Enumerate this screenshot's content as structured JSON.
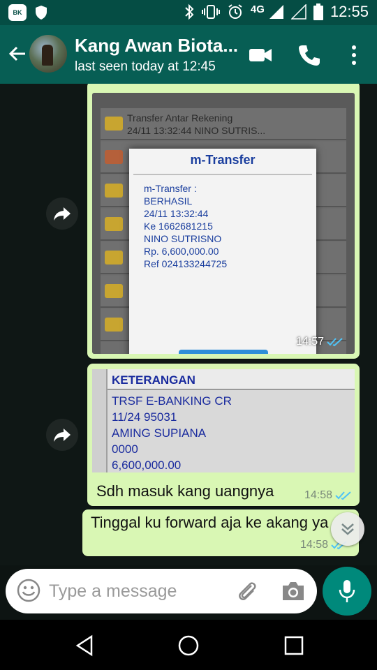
{
  "status_bar": {
    "network": "4G",
    "time": "12:55",
    "app_badge": "BK"
  },
  "header": {
    "contact_name": "Kang Awan Biota...",
    "last_seen": "last seen today at 12:45"
  },
  "messages": [
    {
      "type": "image",
      "time": "14:57",
      "content": {
        "list_rows": [
          {
            "title": "Transfer Antar Rekening",
            "subtitle": "24/11 13:32:44 NINO SUTRIS..."
          }
        ],
        "popup_title": "m-Transfer",
        "popup_lines": [
          "m-Transfer :",
          "BERHASIL",
          "24/11 13:32:44",
          "Ke 1662681215",
          "NINO SUTRISNO",
          "Rp. 6,600,000.00",
          "Ref 024133244725"
        ]
      }
    },
    {
      "type": "image_with_caption",
      "time": "14:58",
      "content": {
        "table_header": "KETERANGAN",
        "table_lines": [
          "TRSF E-BANKING CR",
          "11/24 95031",
          "AMING SUPIANA",
          "0000",
          "6,600,000.00"
        ]
      },
      "caption": "Sdh masuk kang uangnya"
    },
    {
      "type": "text",
      "text": "Tinggal ku forward aja ke akang ya",
      "time": "14:58"
    }
  ],
  "composer": {
    "placeholder": "Type a message"
  },
  "colors": {
    "header": "#075e54",
    "status_bar": "#054d44",
    "outgoing_bubble": "#d9f7b4",
    "accent": "#00897b",
    "read_ticks": "#4fc3f7"
  }
}
